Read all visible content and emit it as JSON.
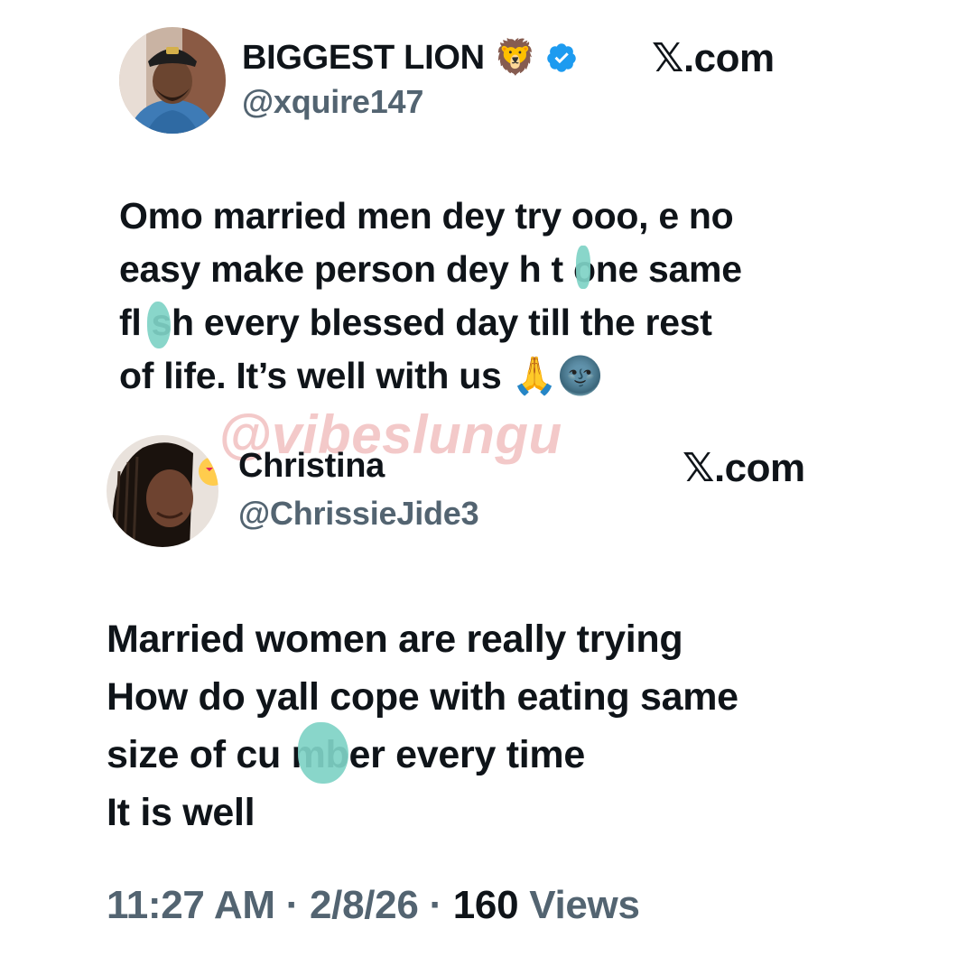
{
  "tweet1": {
    "display_name": "BIGGEST LION",
    "name_emoji": "🦁",
    "verified_icon": "verified-badge-icon",
    "handle": "@xquire147",
    "source_brand": "𝕏.com",
    "lines": [
      "Omo married men dey try ooo, e no",
      "easy make person dey h t one same",
      "fl sh every blessed day till the rest",
      "of life. It’s well with us 🙏🌚"
    ]
  },
  "watermark": "@vibeslungu",
  "tweet2": {
    "display_name": "Christina",
    "handle": "@ChrissieJide3",
    "source_brand": "𝕏.com",
    "lines": [
      "Married women are really trying",
      "How do yall cope with eating same",
      "size of cu  mber every time",
      "It is well"
    ],
    "meta": {
      "time": "11:27 AM",
      "separator": "·",
      "date": "2/8/26",
      "views_count": "160",
      "views_label": "Views"
    }
  },
  "colors": {
    "text_primary": "#0f1419",
    "text_secondary": "#536471",
    "verified_blue": "#1d9bf0",
    "censor_teal": "#7fd3c6",
    "watermark_pink": "#f3c9c9"
  }
}
